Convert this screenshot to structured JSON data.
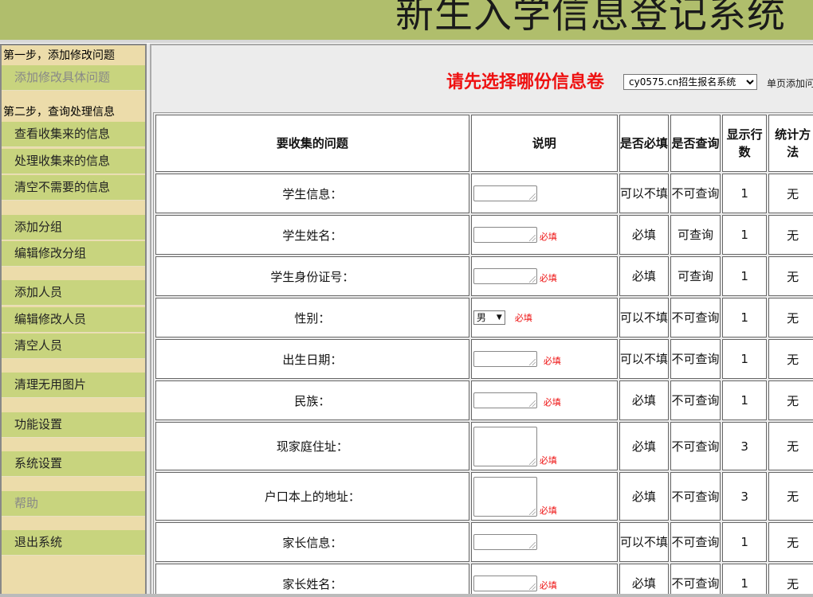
{
  "header": {
    "title": "新生入学信息登记系统"
  },
  "sidebar": {
    "step1": "第一步，添加修改问题",
    "step2": "第二步，查询处理信息",
    "items": [
      {
        "label": "添加修改具体问题"
      },
      {
        "label": "查看收集来的信息"
      },
      {
        "label": "处理收集来的信息"
      },
      {
        "label": "清空不需要的信息"
      },
      {
        "label": "添加分组"
      },
      {
        "label": "编辑修改分组"
      },
      {
        "label": "添加人员"
      },
      {
        "label": "编辑修改人员"
      },
      {
        "label": "清空人员"
      },
      {
        "label": "清理无用图片"
      },
      {
        "label": "功能设置"
      },
      {
        "label": "系统设置"
      },
      {
        "label": "帮助"
      },
      {
        "label": "退出系统"
      }
    ]
  },
  "selector": {
    "prompt": "请先选择哪份信息卷",
    "selected": "cy0575.cn招生报名系统",
    "link": "单页添加问"
  },
  "table": {
    "headers": [
      "要收集的问题",
      "说明",
      "是否必填",
      "是否查询",
      "显示行数",
      "统计方法"
    ],
    "must_label": "必填",
    "rows": [
      {
        "question": "学生信息：",
        "required": "可以不填",
        "query": "不可查询",
        "lines": "1",
        "stat": "无"
      },
      {
        "question": "学生姓名：",
        "required": "必填",
        "query": "可查询",
        "lines": "1",
        "stat": "无"
      },
      {
        "question": "学生身份证号：",
        "required": "必填",
        "query": "可查询",
        "lines": "1",
        "stat": "无"
      },
      {
        "question": "性别：",
        "sex_value": "男",
        "required": "可以不填",
        "query": "不可查询",
        "lines": "1",
        "stat": "无"
      },
      {
        "question": "出生日期：",
        "required": "可以不填",
        "query": "不可查询",
        "lines": "1",
        "stat": "无"
      },
      {
        "question": "民族：",
        "required": "必填",
        "query": "不可查询",
        "lines": "1",
        "stat": "无"
      },
      {
        "question": "现家庭住址：",
        "required": "必填",
        "query": "不可查询",
        "lines": "3",
        "stat": "无"
      },
      {
        "question": "户口本上的地址：",
        "required": "必填",
        "query": "不可查询",
        "lines": "3",
        "stat": "无"
      },
      {
        "question": "家长信息：",
        "required": "可以不填",
        "query": "不可查询",
        "lines": "1",
        "stat": "无"
      },
      {
        "question": "家长姓名：",
        "required": "必填",
        "query": "不可查询",
        "lines": "1",
        "stat": "无"
      }
    ]
  }
}
